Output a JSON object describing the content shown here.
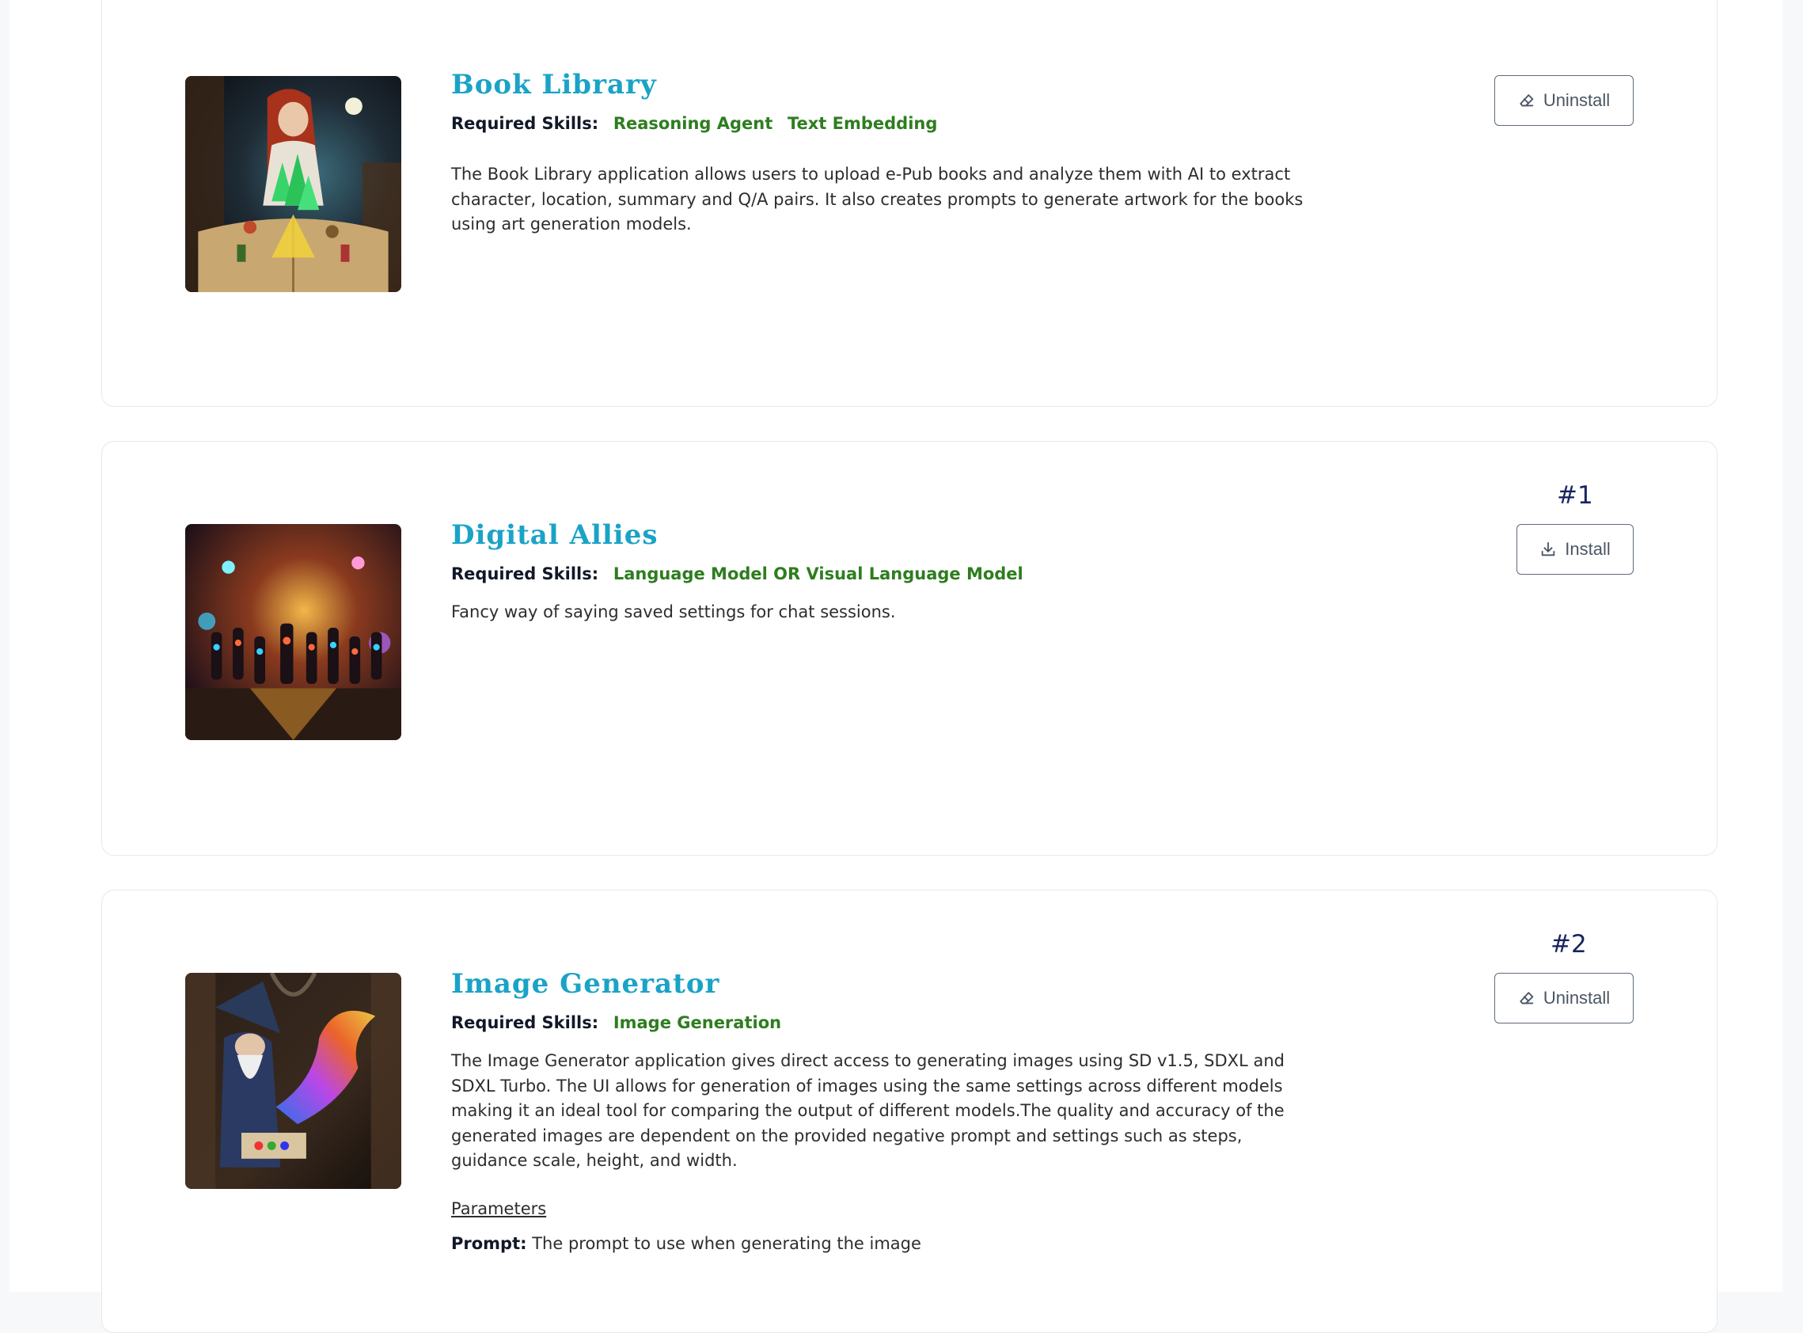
{
  "apps": [
    {
      "title": "Book Library",
      "skills_label": "Required Skills:",
      "skills": [
        "Reasoning Agent",
        "Text Embedding"
      ],
      "description": "The Book Library application allows users to upload e-Pub books and analyze them with AI to extract character, location, summary and Q/A pairs. It also creates prompts to generate artwork for the books using art generation models.",
      "action": {
        "label": "Uninstall",
        "icon": "eraser-icon"
      }
    },
    {
      "rank": "#1",
      "title": "Digital Allies",
      "skills_label": "Required Skills:",
      "skills": [
        "Language Model OR Visual Language Model"
      ],
      "description": "Fancy way of saying saved settings for chat sessions.",
      "action": {
        "label": "Install",
        "icon": "download-icon"
      }
    },
    {
      "rank": "#2",
      "title": "Image Generator",
      "skills_label": "Required Skills:",
      "skills": [
        "Image Generation"
      ],
      "description": "The Image Generator application gives direct access to generating images using SD v1.5, SDXL and SDXL Turbo. The UI allows for generation of images using the same settings across different models making it an ideal tool for comparing the output of different models.The quality and accuracy of the generated images are dependent on the provided negative prompt and settings such as steps, guidance scale, height, and width.",
      "parameters_link": "Parameters",
      "parameter": {
        "name": "Prompt:",
        "text": "The prompt to use when generating the image"
      },
      "action": {
        "label": "Uninstall",
        "icon": "eraser-icon"
      }
    }
  ],
  "colors": {
    "title": "#1aa3c7",
    "skill": "#2e7d1f",
    "rank": "#1a2460"
  }
}
